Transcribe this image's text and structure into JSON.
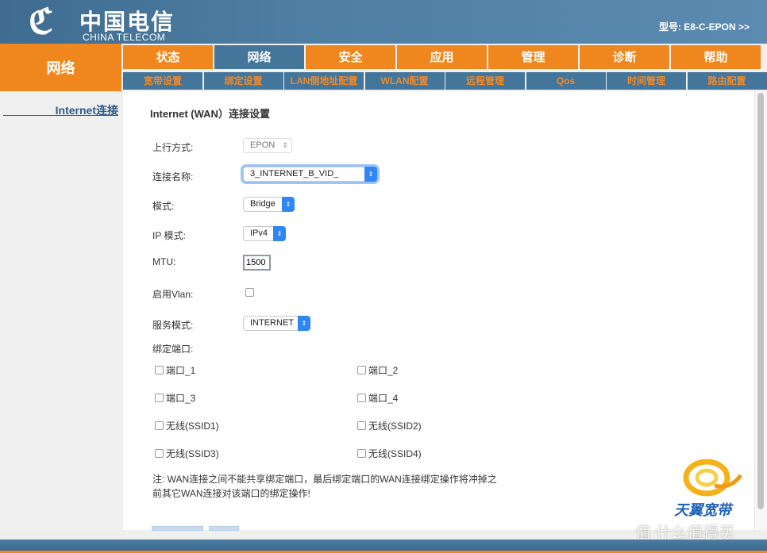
{
  "header": {
    "logo_cn": "中国电信",
    "logo_en": "CHINA TELECOM",
    "model": "型号: E8-C-EPON >>"
  },
  "section": "网络",
  "main_tabs": [
    {
      "label": "状态"
    },
    {
      "label": "网络",
      "active": true
    },
    {
      "label": "安全"
    },
    {
      "label": "应用"
    },
    {
      "label": "管理"
    },
    {
      "label": "诊断"
    },
    {
      "label": "帮助"
    }
  ],
  "sub_tabs": [
    {
      "label": "宽带设置"
    },
    {
      "label": "绑定设置"
    },
    {
      "label": "LAN侧地址配置"
    },
    {
      "label": "WLAN配置"
    },
    {
      "label": "远程管理"
    },
    {
      "label": "Qos"
    },
    {
      "label": "时间管理"
    },
    {
      "label": "路由配置"
    }
  ],
  "sidebar": {
    "items": [
      {
        "label": "Internet连接"
      }
    ]
  },
  "form": {
    "title": "Internet (WAN）连接设置",
    "uplink_label": "上行方式:",
    "uplink_value": "EPON",
    "conn_name_label": "连接名称:",
    "conn_name_value": "3_INTERNET_B_VID_",
    "mode_label": "模式:",
    "mode_value": "Bridge",
    "ip_mode_label": "IP 模式:",
    "ip_mode_value": "IPv4",
    "mtu_label": "MTU:",
    "mtu_value": "1500",
    "vlan_label": "启用Vlan:",
    "vlan_checked": false,
    "service_label": "服务模式:",
    "service_value": "INTERNET",
    "bind_label": "绑定端口:",
    "ports": [
      "端口_1",
      "端口_2",
      "端口_3",
      "端口_4",
      "无线(SSID1)",
      "无线(SSID2)",
      "无线(SSID3)",
      "无线(SSID4)"
    ],
    "note_line1": "注: WAN连接之间不能共享绑定端口，最后绑定端口的WAN连接绑定操作将冲掉之",
    "note_line2": "前其它WAN连接对该端口的绑定操作!"
  },
  "brand": {
    "logo_text": "天翼宽带",
    "watermark": "值 什么值得买"
  },
  "colors": {
    "orange": "#ef861e",
    "blue": "#44759a",
    "accent": "#2f86f5"
  }
}
